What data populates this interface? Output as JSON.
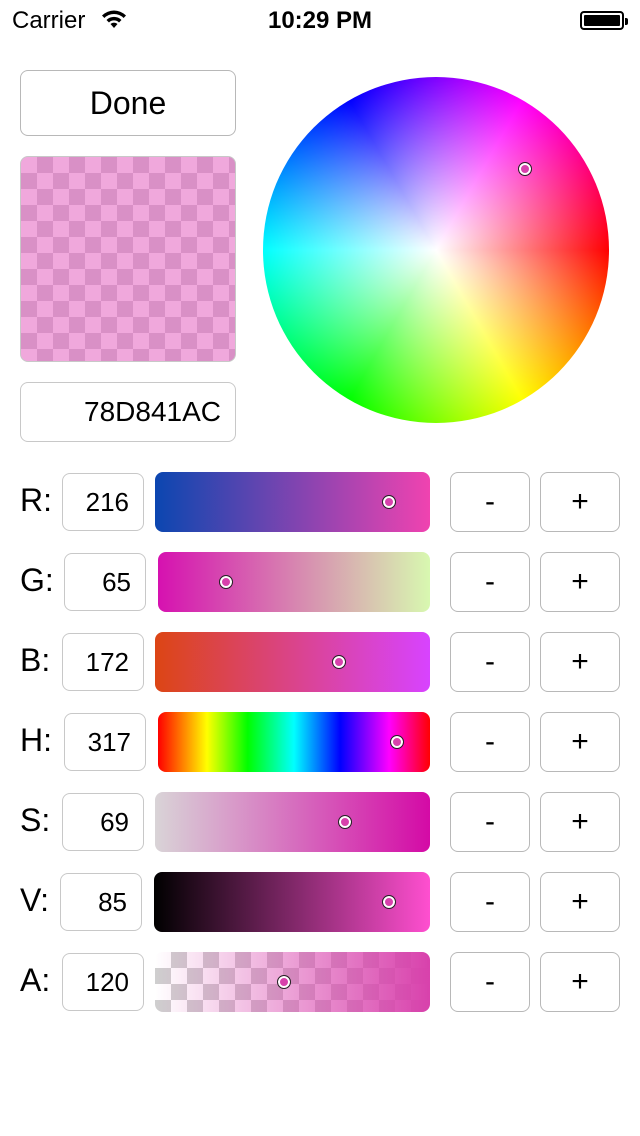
{
  "status_bar": {
    "carrier": "Carrier",
    "time": "10:29 PM"
  },
  "done_label": "Done",
  "hex_value": "78D841AC",
  "selected_color": "#d841ac",
  "wheel_handle": {
    "hue_deg": 317,
    "saturation_pct": 69
  },
  "channels": [
    {
      "label": "R:",
      "value": "216",
      "level": 0.85,
      "minus": "-",
      "plus": "+",
      "gradient": [
        "#0b46b0",
        "#f043b0"
      ]
    },
    {
      "label": "G:",
      "value": "65",
      "level": 0.25,
      "minus": "-",
      "plus": "+",
      "gradient": [
        "#d611b0",
        "#d8f8b0"
      ]
    },
    {
      "label": "B:",
      "value": "172",
      "level": 0.67,
      "minus": "-",
      "plus": "+",
      "gradient": [
        "#dc4514",
        "#d843ff"
      ]
    },
    {
      "label": "H:",
      "value": "317",
      "level": 0.88,
      "minus": "-",
      "plus": "+",
      "gradient": [
        "hue"
      ]
    },
    {
      "label": "S:",
      "value": "69",
      "level": 0.69,
      "minus": "-",
      "plus": "+",
      "gradient": [
        "#d9d4d7",
        "#d40aa6"
      ]
    },
    {
      "label": "V:",
      "value": "85",
      "level": 0.85,
      "minus": "-",
      "plus": "+",
      "gradient": [
        "#000000",
        "#ff4fd0"
      ]
    },
    {
      "label": "A:",
      "value": "120",
      "level": 0.47,
      "minus": "-",
      "plus": "+",
      "gradient": [
        "alpha"
      ]
    }
  ]
}
